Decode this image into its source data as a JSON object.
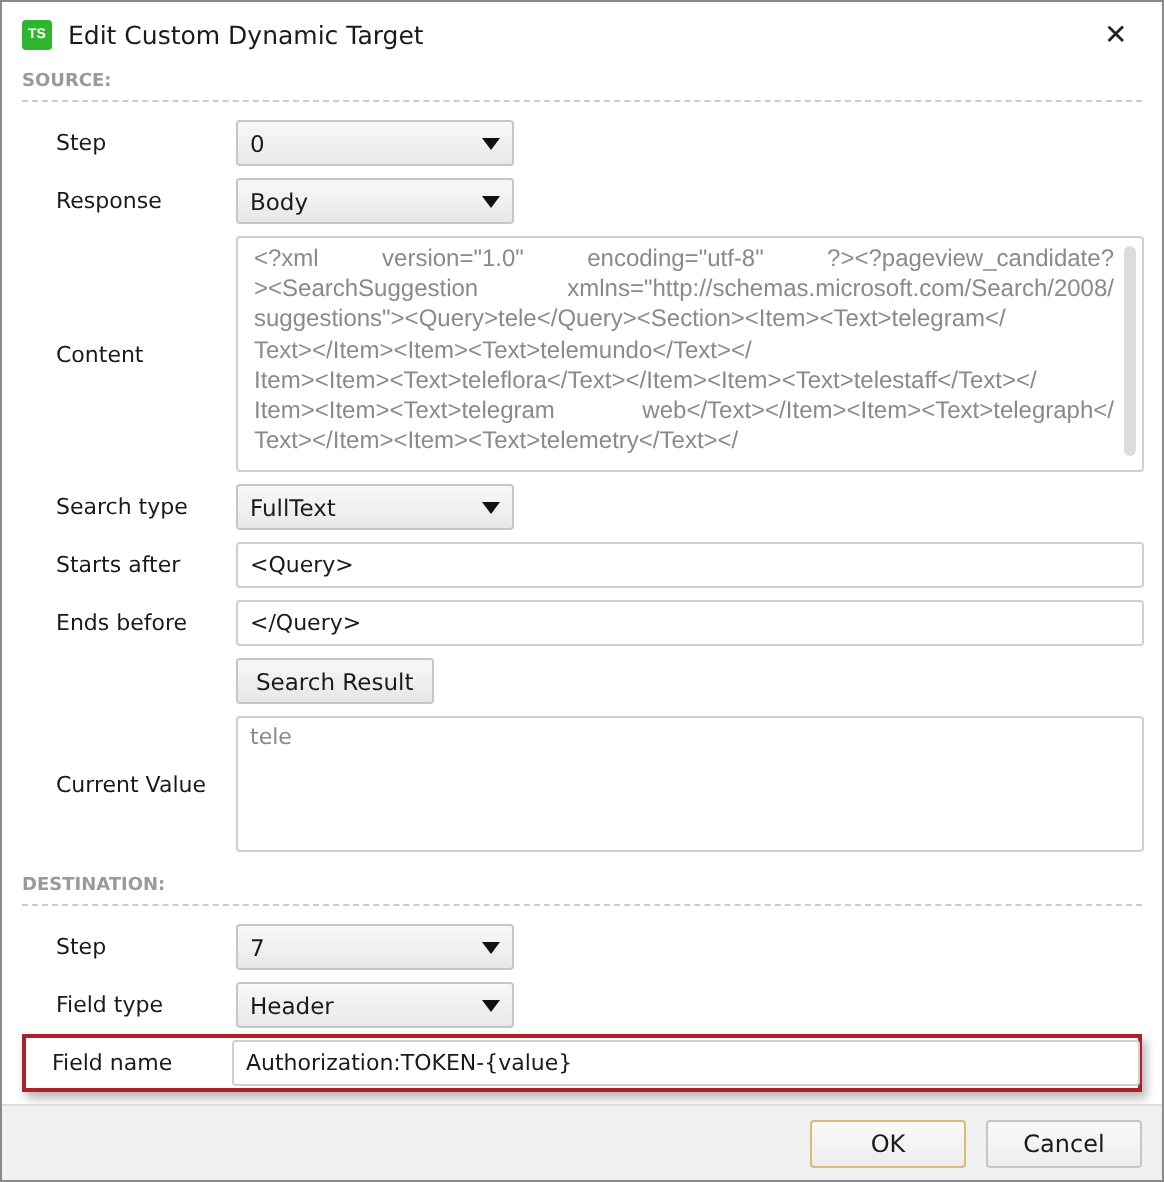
{
  "window": {
    "title": "Edit Custom Dynamic Target",
    "app_badge": "TS",
    "close": "✕"
  },
  "sections": [
    {
      "title": "SOURCE:",
      "rows": [
        {
          "kind": "select",
          "label": "Step",
          "value": "0",
          "highlighted": false
        },
        {
          "kind": "select",
          "label": "Response",
          "value": "Body",
          "highlighted": false
        },
        {
          "kind": "textarea",
          "label": "Content",
          "lines": [
            "<?xml version=\"1.0\" encoding=\"utf-8\" ?><?pageview_candidate?",
            "><SearchSuggestion xmlns=\"http://schemas.microsoft.com/Search/2008/",
            "suggestions\"><Query>tele</Query><Section><Item><Text>telegram</",
            "Text></Item><Item><Text>telemundo</Text></",
            "Item><Item><Text>teleflora</Text></Item><Item><Text>telestaff</Text></",
            "Item><Item><Text>telegram web</Text></Item><Item><Text>telegraph</",
            "Text></Item><Item><Text>telemetry</Text></"
          ],
          "highlighted": false
        },
        {
          "kind": "select",
          "label": "Search type",
          "value": "FullText",
          "highlighted": false
        },
        {
          "kind": "text",
          "label": "Starts after",
          "value": "<Query>",
          "highlighted": false
        },
        {
          "kind": "text",
          "label": "Ends before",
          "value": "</Query>",
          "highlighted": false
        },
        {
          "kind": "button",
          "label": "Search Result",
          "highlighted": false
        },
        {
          "kind": "output",
          "label": "Current Value",
          "placeholder": "tele",
          "highlighted": false
        }
      ]
    },
    {
      "title": "DESTINATION:",
      "rows": [
        {
          "kind": "select",
          "label": "Step",
          "value": "7",
          "highlighted": false
        },
        {
          "kind": "select",
          "label": "Field type",
          "value": "Header",
          "highlighted": false
        },
        {
          "kind": "text",
          "label": "Field name",
          "value": "Authorization:TOKEN-{value}",
          "highlighted": true
        }
      ]
    }
  ],
  "buttons": [
    {
      "label": "OK",
      "default": true
    },
    {
      "label": "Cancel",
      "default": false
    }
  ]
}
